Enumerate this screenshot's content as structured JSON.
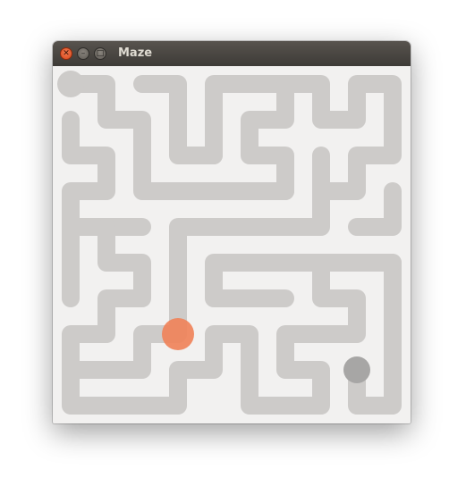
{
  "window": {
    "title": "Maze",
    "buttons": [
      {
        "name": "close",
        "glyph": "✕",
        "icon": "close-icon"
      },
      {
        "name": "minimize",
        "glyph": "–",
        "icon": "minimize-icon"
      },
      {
        "name": "maximize",
        "glyph": "□",
        "icon": "maximize-icon"
      }
    ]
  },
  "maze": {
    "cols": 10,
    "rows": 10,
    "colors": {
      "background": "#f2f1f0",
      "path": "#cdcbc9",
      "player": "#f0835a",
      "goal": "#a7a6a5"
    },
    "paths": [
      [
        [
          0,
          0
        ],
        [
          1,
          0
        ],
        [
          1,
          1
        ],
        [
          2,
          1
        ],
        [
          2,
          3
        ],
        [
          6,
          3
        ]
      ],
      [
        [
          2,
          0
        ],
        [
          3,
          0
        ],
        [
          3,
          2
        ],
        [
          4,
          2
        ]
      ],
      [
        [
          4,
          2
        ],
        [
          4,
          0
        ],
        [
          7,
          0
        ],
        [
          7,
          1
        ],
        [
          8,
          1
        ],
        [
          8,
          0
        ],
        [
          9,
          0
        ],
        [
          9,
          2
        ],
        [
          8,
          2
        ],
        [
          8,
          3
        ],
        [
          7,
          3
        ]
      ],
      [
        [
          6,
          0
        ],
        [
          6,
          1
        ],
        [
          5,
          1
        ],
        [
          5,
          2
        ],
        [
          6,
          2
        ],
        [
          6,
          3
        ]
      ],
      [
        [
          7,
          2
        ],
        [
          7,
          4
        ],
        [
          3,
          4
        ],
        [
          3,
          7
        ]
      ],
      [
        [
          0,
          1
        ],
        [
          0,
          2
        ],
        [
          1,
          2
        ],
        [
          1,
          3
        ],
        [
          0,
          3
        ],
        [
          0,
          6
        ]
      ],
      [
        [
          0,
          4
        ],
        [
          2,
          4
        ]
      ],
      [
        [
          1,
          4
        ],
        [
          1,
          5
        ],
        [
          2,
          5
        ],
        [
          2,
          6
        ],
        [
          1,
          6
        ],
        [
          1,
          7
        ],
        [
          0,
          7
        ],
        [
          0,
          9
        ],
        [
          3,
          9
        ],
        [
          3,
          8
        ],
        [
          4,
          8
        ],
        [
          4,
          7
        ],
        [
          5,
          7
        ],
        [
          5,
          9
        ],
        [
          7,
          9
        ],
        [
          7,
          8
        ],
        [
          6,
          8
        ],
        [
          6,
          7
        ],
        [
          8,
          7
        ],
        [
          8,
          6
        ],
        [
          7,
          6
        ],
        [
          7,
          5
        ],
        [
          9,
          5
        ],
        [
          9,
          9
        ],
        [
          8,
          9
        ],
        [
          8,
          8
        ]
      ],
      [
        [
          0,
          8
        ],
        [
          2,
          8
        ],
        [
          2,
          7
        ],
        [
          3,
          7
        ]
      ],
      [
        [
          8,
          4
        ],
        [
          9,
          4
        ],
        [
          9,
          3
        ]
      ],
      [
        [
          9,
          5
        ],
        [
          4,
          5
        ],
        [
          4,
          6
        ],
        [
          6,
          6
        ]
      ]
    ],
    "player": {
      "col": 3,
      "row": 7
    },
    "goal": {
      "col": 8,
      "row": 8
    }
  }
}
